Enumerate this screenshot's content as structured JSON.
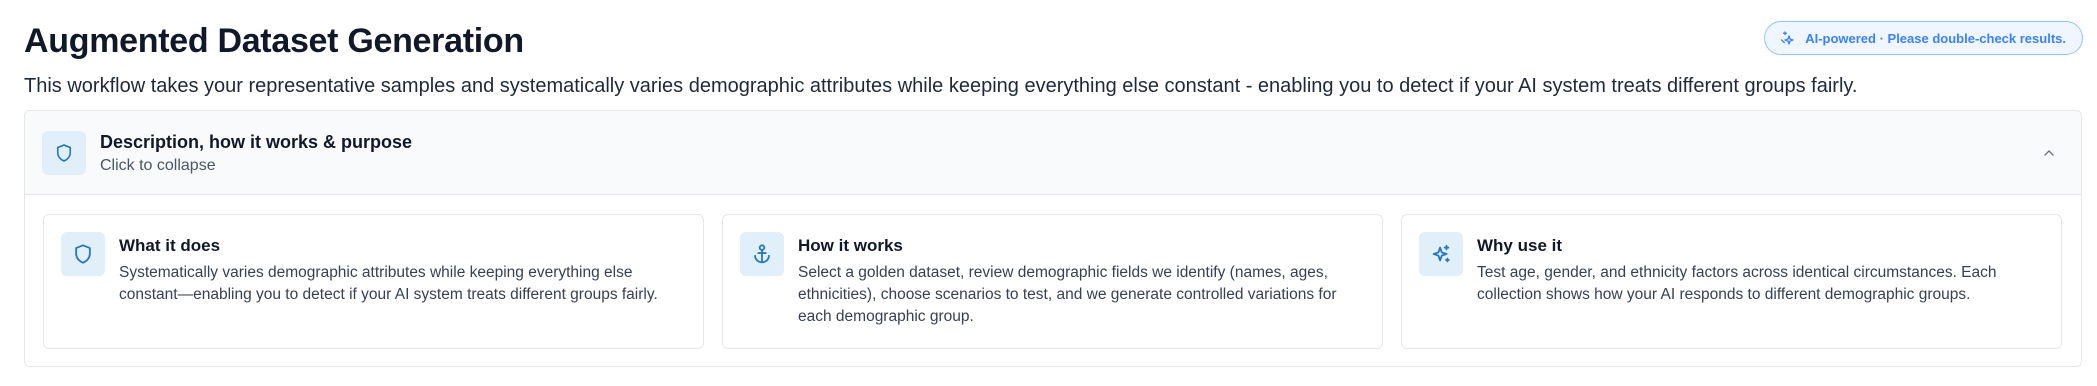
{
  "header": {
    "title": "Augmented Dataset Generation",
    "ai_badge": "AI-powered · Please double-check results.",
    "subtitle": "This workflow takes your representative samples and systematically varies demographic attributes while keeping everything else constant - enabling you to detect if your AI system treats different groups fairly."
  },
  "info_card": {
    "title": "Description, how it works & purpose",
    "subtitle": "Click to collapse",
    "icon": "shield-icon",
    "toggle_icon": "chevron-up-icon",
    "columns": [
      {
        "icon": "shield-icon",
        "title": "What it does",
        "body": "Systematically varies demographic attributes while keeping everything else constant—enabling you to detect if your AI system treats different groups fairly."
      },
      {
        "icon": "anchor-icon",
        "title": "How it works",
        "body": "Select a golden dataset, review demographic fields we identify (names, ages, ethnicities), choose scenarios to test, and we generate controlled variations for each demographic group."
      },
      {
        "icon": "sparkles-icon",
        "title": "Why use it",
        "body": "Test age, gender, and ethnicity factors across identical circumstances. Each collection shows how your AI responds to different demographic groups."
      }
    ]
  },
  "colors": {
    "accent": "#2a7ab8",
    "icon_bg": "#e0effa",
    "badge_border": "#93c5fd",
    "badge_text": "#3b82f6"
  }
}
